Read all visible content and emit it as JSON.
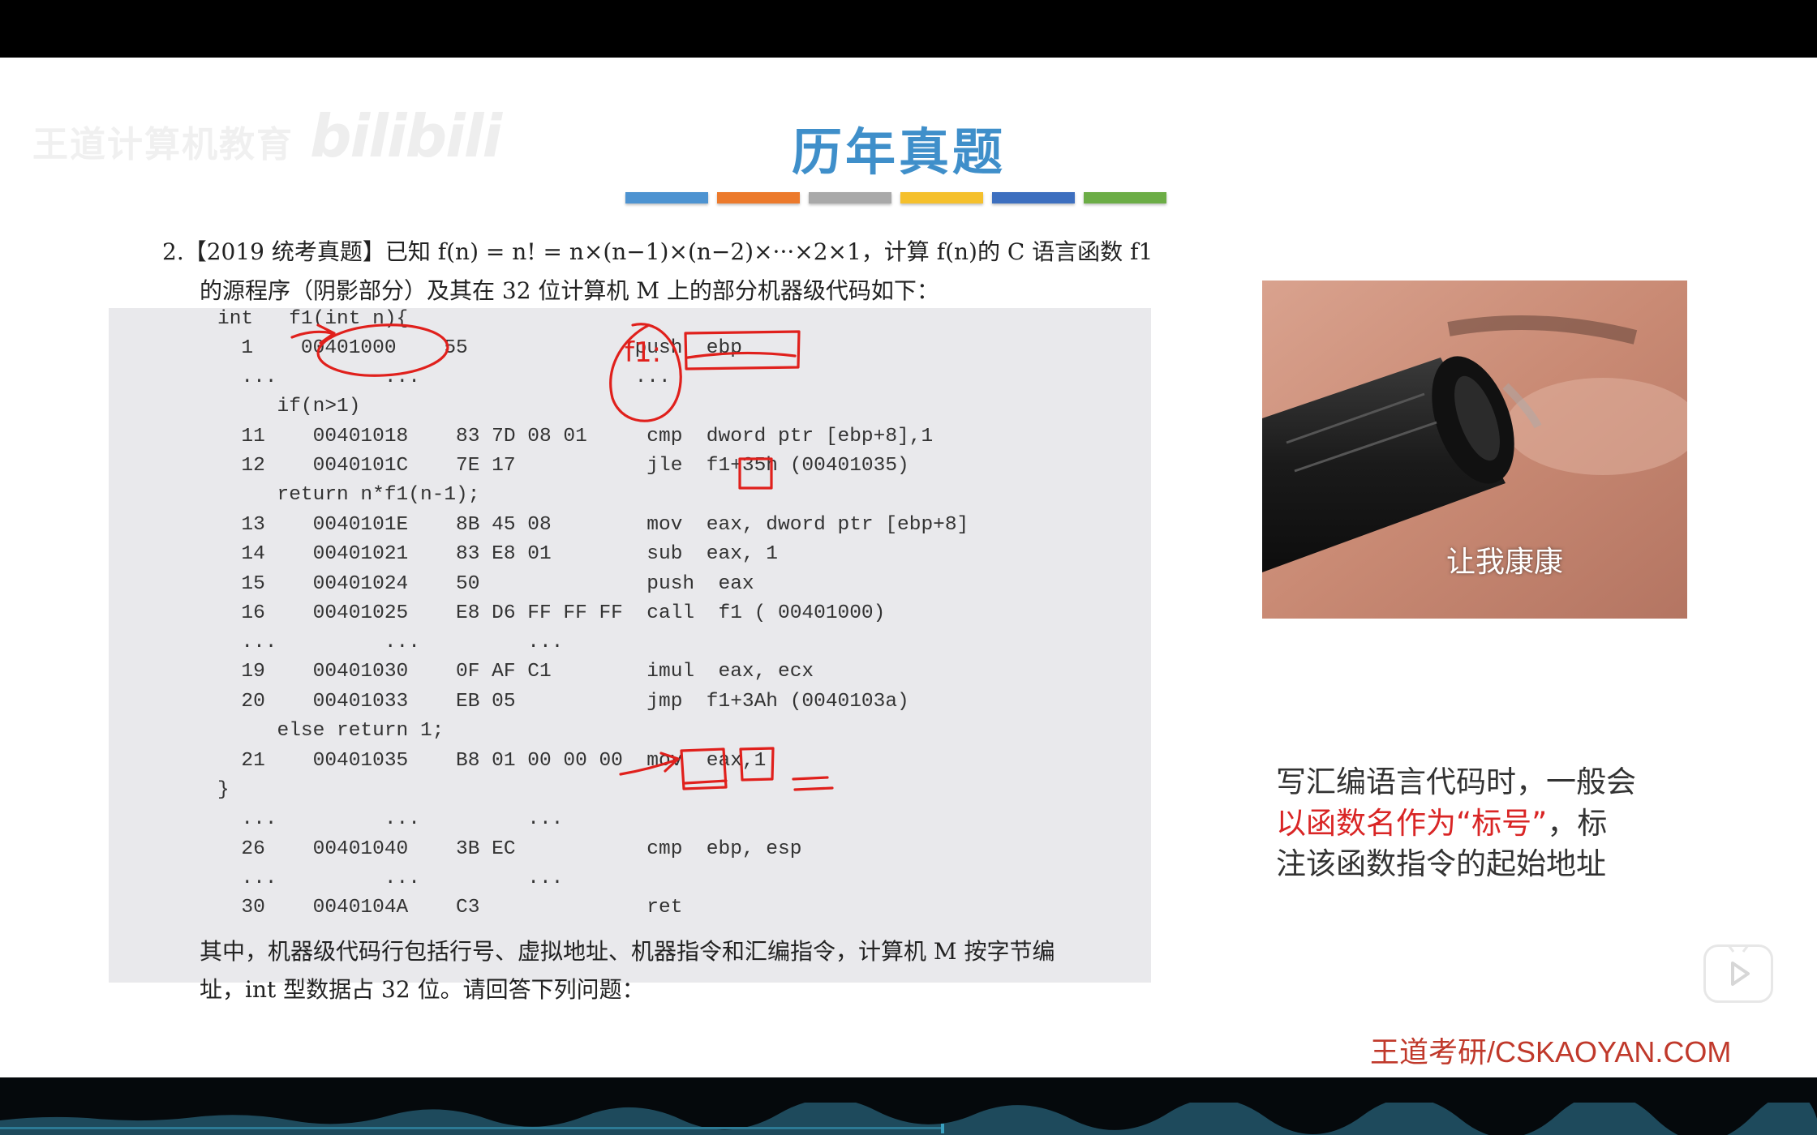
{
  "watermark": {
    "brand": "王道计算机教育",
    "site": "bilibili"
  },
  "slide": {
    "title": "历年真题"
  },
  "accent_colors": [
    "#4d93d1",
    "#ec7a2c",
    "#a9a9a9",
    "#f5c02c",
    "#3d6fbf",
    "#6cad46"
  ],
  "question": {
    "line1": "2.【2019 统考真题】已知 f(n) = n! = n×(n−1)×(n−2)×···×2×1，计算 f(n)的 C 语言函数 f1",
    "line2": "的源程序（阴影部分）及其在 32 位计算机 M 上的部分机器级代码如下：",
    "footer1": "其中，机器级代码行包括行号、虚拟地址、机器指令和汇编指令，计算机 M 按字节编",
    "footer2": "址，int 型数据占 32 位。请回答下列问题："
  },
  "code_lines": [
    "int   f1(int n){",
    "  1    00401000    55              push  ebp",
    "  ...         ...                  ...",
    "     if(n>1)",
    "  11    00401018    83 7D 08 01     cmp  dword ptr [ebp+8],1",
    "  12    0040101C    7E 17           jle  f1+35h (00401035)",
    "     return n*f1(n-1);",
    "  13    0040101E    8B 45 08        mov  eax, dword ptr [ebp+8]",
    "  14    00401021    83 E8 01        sub  eax, 1",
    "  15    00401024    50              push  eax",
    "  16    00401025    E8 D6 FF FF FF  call  f1 ( 00401000)",
    "  ...         ...         ...",
    "  19    00401030    0F AF C1        imul  eax, ecx",
    "  20    00401033    EB 05           jmp  f1+3Ah (0040103a)",
    "     else return 1;",
    "  21    00401035    B8 01 00 00 00  mov  eax,1",
    "}",
    "  ...         ...         ...",
    "  26    00401040    3B EC           cmp  ebp, esp",
    "  ...         ...         ...",
    "  30    0040104A    C3              ret"
  ],
  "annotation": {
    "label": "f1:"
  },
  "camera": {
    "caption": "让我康康"
  },
  "note": {
    "line1": "写汇编语言代码时，一般会",
    "line2_red": "以函数名作为“标号”",
    "line2_rest": "，标",
    "line3": "注该函数指令的起始地址"
  },
  "footer": {
    "brand": "王道考研/CSKAOYAN.COM"
  }
}
